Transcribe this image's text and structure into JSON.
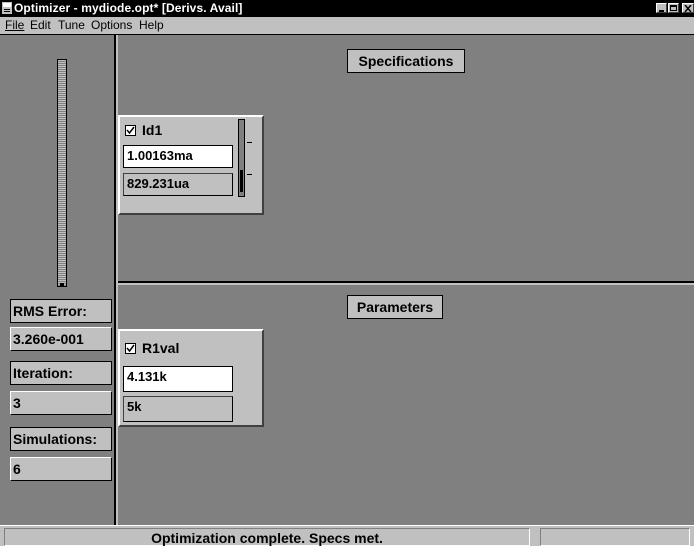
{
  "window": {
    "title": "Optimizer - mydiode.opt*  [Derivs. Avail]"
  },
  "menu": [
    {
      "label": "File"
    },
    {
      "label": "Edit"
    },
    {
      "label": "Tune"
    },
    {
      "label": "Options"
    },
    {
      "label": "Help"
    }
  ],
  "left_panel": {
    "rms_error_label": "RMS Error:",
    "rms_error_value": "3.260e-001",
    "iteration_label": "Iteration:",
    "iteration_value": "3",
    "simulations_label": "Simulations:",
    "simulations_value": "6"
  },
  "specifications": {
    "header": "Specifications",
    "items": [
      {
        "name": "Id1",
        "checked": true,
        "current_value": "1.00163ma",
        "target_value": "829.231ua"
      }
    ]
  },
  "parameters": {
    "header": "Parameters",
    "items": [
      {
        "name": "R1val",
        "checked": true,
        "current_value": "4.131k",
        "initial_value": "5k"
      }
    ]
  },
  "status_bar": {
    "message": "Optimization complete.  Specs met."
  },
  "icons": {
    "app": "optimizer-app-icon",
    "minimize": "minimize-icon",
    "maximize": "maximize-icon",
    "close": "close-icon",
    "checkmark": "checkmark-icon"
  }
}
